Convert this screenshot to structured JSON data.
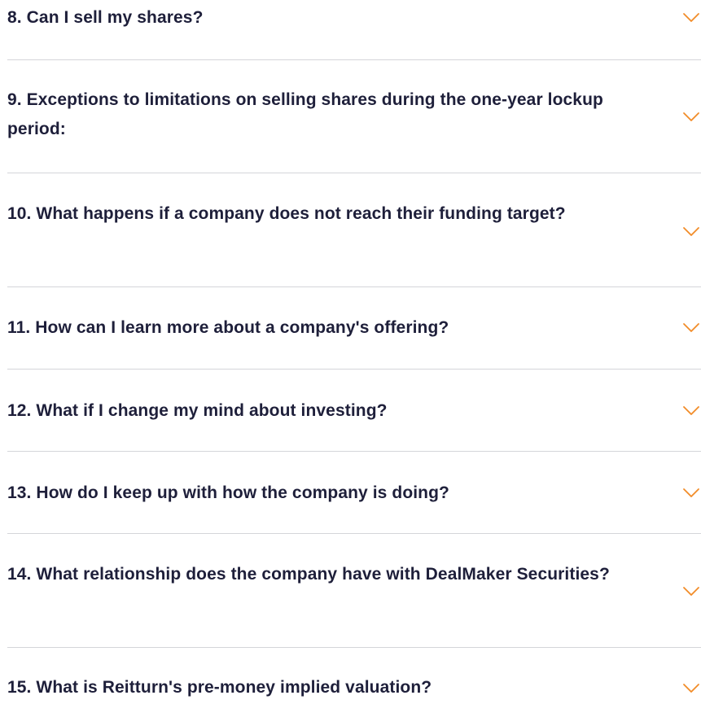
{
  "accent_color": "#f28c28",
  "faq": {
    "items": [
      {
        "question": "8. Can I sell my shares?",
        "icon": "chevron-down-icon"
      },
      {
        "question": "9. Exceptions to limitations on selling shares during the one-year lockup period:",
        "icon": "chevron-down-icon"
      },
      {
        "question": "10. What happens if a company does not reach their funding target?",
        "icon": "chevron-down-icon"
      },
      {
        "question": "11. How can I learn more about a company's offering?",
        "icon": "chevron-down-icon"
      },
      {
        "question": "12. What if I change my mind about investing?",
        "icon": "chevron-down-icon"
      },
      {
        "question": "13. How do I keep up with how the company is doing?",
        "icon": "chevron-down-icon"
      },
      {
        "question": "14. What relationship does the company have with DealMaker Securities?",
        "icon": "chevron-down-icon"
      },
      {
        "question": "15. What is Reitturn's pre-money implied valuation?",
        "icon": "chevron-down-icon"
      }
    ]
  }
}
